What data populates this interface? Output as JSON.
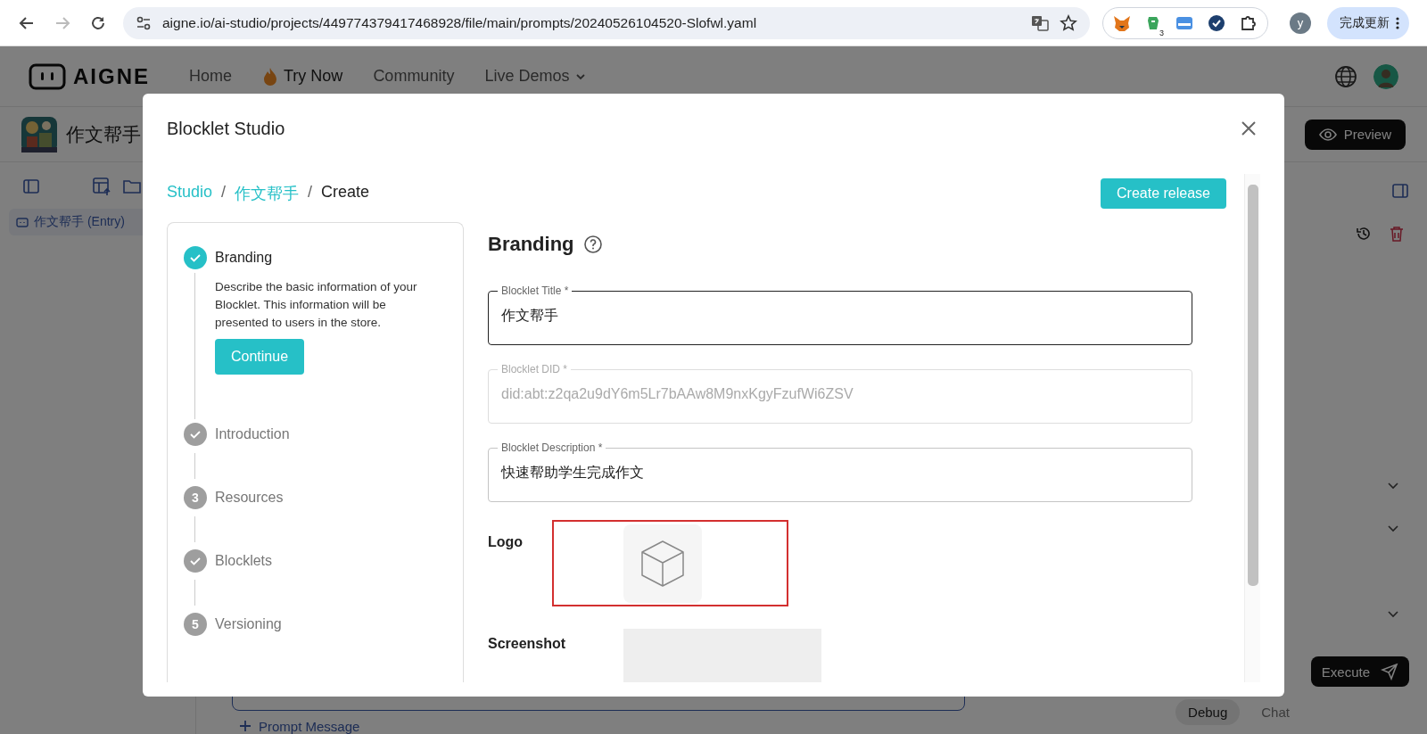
{
  "browser": {
    "url": "aigne.io/ai-studio/projects/449774379417468928/file/main/prompts/20240526104520-Slofwl.yaml",
    "forward_disabled": true,
    "extension_badge": "3",
    "profile_initial": "y",
    "update_button": "完成更新"
  },
  "app": {
    "logo": "AIGNE",
    "nav": [
      {
        "label": "Home",
        "kind": "plain"
      },
      {
        "label": "Try Now",
        "kind": "fire"
      },
      {
        "label": "Community",
        "kind": "plain"
      },
      {
        "label": "Live Demos",
        "kind": "dropdown"
      }
    ],
    "project_title": "作文帮手",
    "preview_button": "Preview",
    "sidebar_item": "作文帮手 (Entry)",
    "execute_button": "Execute",
    "mode_tabs": [
      {
        "label": "Debug",
        "selected": true
      },
      {
        "label": "Chat",
        "selected": false
      }
    ],
    "prompt_message": "Prompt Message"
  },
  "modal": {
    "title": "Blocklet Studio",
    "breadcrumb": [
      {
        "label": "Studio",
        "kind": "link"
      },
      {
        "label": "/",
        "kind": "separator"
      },
      {
        "label": "作文帮手",
        "kind": "link"
      },
      {
        "label": "/",
        "kind": "separator"
      },
      {
        "label": "Create",
        "kind": "current"
      }
    ],
    "create_release": "Create release",
    "steps": [
      {
        "label": "Branding",
        "completed": true,
        "active": true,
        "description": "Describe the basic information of your Blocklet. This information will be presented to users in the store.",
        "button": "Continue"
      },
      {
        "label": "Introduction",
        "completed": true,
        "active": false
      },
      {
        "label": "Resources",
        "completed": false,
        "active": false,
        "number": "3"
      },
      {
        "label": "Blocklets",
        "completed": true,
        "active": false
      },
      {
        "label": "Versioning",
        "completed": false,
        "active": false,
        "number": "5"
      }
    ],
    "section_title": "Branding",
    "fields": [
      {
        "label": "Blocklet Title *",
        "value": "作文帮手",
        "focused": true,
        "disabled": false
      },
      {
        "label": "Blocklet DID *",
        "value": "did:abt:z2qa2u9dY6m5Lr7bAAw8M9nxKgyFzufWi6ZSV",
        "focused": false,
        "disabled": true
      },
      {
        "label": "Blocklet Description *",
        "value": "快速帮助学生完成作文",
        "focused": false,
        "disabled": false
      }
    ],
    "logo_label": "Logo",
    "logo_highlighted": true,
    "screenshot_label": "Screenshot"
  }
}
